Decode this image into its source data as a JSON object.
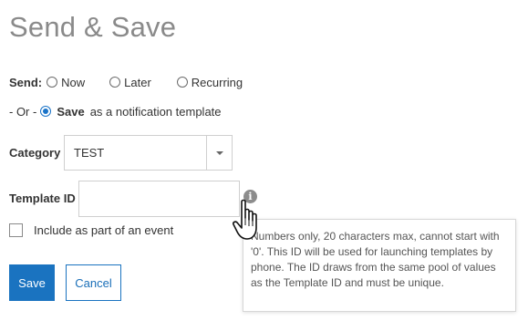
{
  "header": {
    "title": "Send & Save"
  },
  "send": {
    "label": "Send:",
    "options": [
      {
        "label": "Now",
        "selected": false
      },
      {
        "label": "Later",
        "selected": false
      },
      {
        "label": "Recurring",
        "selected": false
      }
    ]
  },
  "save_option": {
    "or_label": "- Or -",
    "save_label": "Save",
    "suffix": "as a notification template",
    "selected": true
  },
  "category": {
    "label": "Category",
    "value": "TEST"
  },
  "template_id": {
    "label": "Template ID",
    "value": "",
    "info_icon": "info-icon"
  },
  "tooltip": {
    "text": "Numbers only, 20 characters max, cannot start with '0'. This ID will be used for launching templates by phone. The ID draws from the same pool of values as the Template ID and must be unique."
  },
  "event_checkbox": {
    "label": "Include as part of an event",
    "checked": false
  },
  "buttons": {
    "save_label": "Save",
    "cancel_label": "Cancel"
  },
  "colors": {
    "primary": "#1a73c0",
    "title_gray": "#8a8a8a",
    "info_icon_gray": "#8c8c8c"
  }
}
